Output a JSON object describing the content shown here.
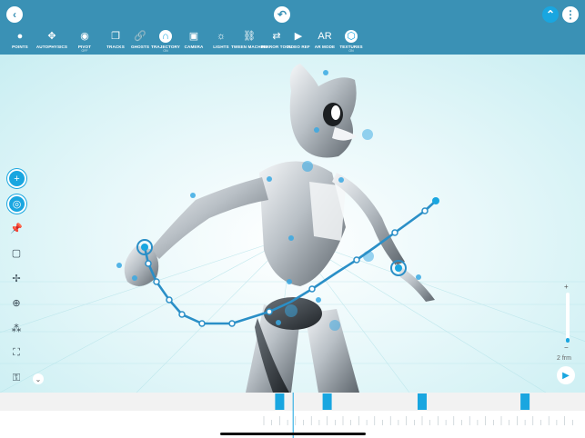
{
  "toolbar": {
    "tools": [
      {
        "label": "POINTS",
        "sub": "",
        "icon": "points-icon",
        "glyph": "●",
        "active": false
      },
      {
        "label": "AUTOPHYSICS",
        "sub": "",
        "icon": "figure-icon",
        "glyph": "✥",
        "active": false
      },
      {
        "label": "PIVOT",
        "sub": "OFF",
        "icon": "pivot-icon",
        "glyph": "◉",
        "active": false
      },
      {
        "label": "TRACKS",
        "sub": "",
        "icon": "tracks-icon",
        "glyph": "❐",
        "active": false
      },
      {
        "label": "GHOSTS",
        "sub": "",
        "icon": "link-icon",
        "glyph": "🔗",
        "active": false
      },
      {
        "label": "TRAJECTORY",
        "sub": "ON",
        "icon": "trajectory-icon",
        "glyph": "∩",
        "active": true
      },
      {
        "label": "CAMERA",
        "sub": "",
        "icon": "camera-icon",
        "glyph": "▣",
        "active": false
      },
      {
        "label": "LIGHTS",
        "sub": "",
        "icon": "sun-icon",
        "glyph": "☼",
        "active": false
      },
      {
        "label": "TWEEN MACHINE",
        "sub": "",
        "icon": "tween-icon",
        "glyph": "⛓",
        "active": false
      },
      {
        "label": "MIRROR TOOL",
        "sub": "",
        "icon": "mirror-icon",
        "glyph": "⇄",
        "active": false
      },
      {
        "label": "VIDEO REF",
        "sub": "",
        "icon": "video-icon",
        "glyph": "▶",
        "active": false
      },
      {
        "label": "AR MODE",
        "sub": "",
        "icon": "ar-icon",
        "glyph": "AR",
        "active": false
      },
      {
        "label": "TEXTURES",
        "sub": "ON",
        "icon": "texture-icon",
        "glyph": "⬡",
        "active": true
      }
    ],
    "accent": "#19a6e0",
    "bar_color": "#3a91b5"
  },
  "right_panel": {
    "frame_rate_label": "2 frm",
    "zoom_plus": "+",
    "zoom_minus": "−",
    "zoom_level": 0.1
  },
  "left_panel": {
    "tools": [
      "add-joint-icon",
      "target-icon",
      "pin-icon",
      "frame-icon",
      "move-icon",
      "rotate-icon",
      "nodes-icon",
      "expand-icon",
      "key-icon"
    ]
  },
  "timeline": {
    "keyframes": [
      2,
      8,
      20,
      33
    ],
    "playhead": 6,
    "frame_count": 40
  }
}
